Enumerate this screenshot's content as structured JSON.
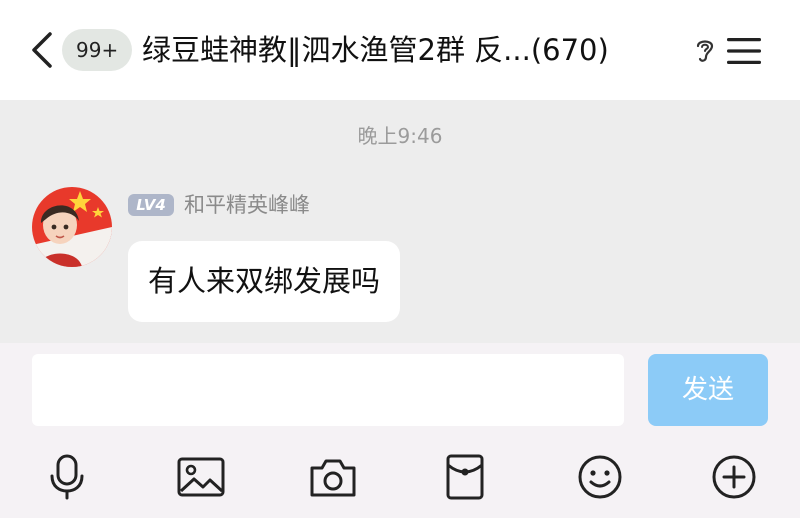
{
  "header": {
    "unread_badge": "99+",
    "title": "绿豆蛙神教‖泗水渔管2群 反...(670)"
  },
  "chat": {
    "timestamp": "晚上9:46",
    "messages": [
      {
        "level": "LV4",
        "sender": "和平精英峰峰",
        "text": "有人来双绑发展吗"
      }
    ]
  },
  "composer": {
    "input_value": "",
    "send_label": "发送"
  },
  "toolbar": {
    "icons": [
      "microphone-icon",
      "image-icon",
      "camera-icon",
      "red-packet-icon",
      "emoji-icon",
      "plus-icon"
    ]
  },
  "colors": {
    "send_button": "#8ccbf7",
    "chat_background": "#ededed",
    "level_badge": "#aeb6c9"
  }
}
